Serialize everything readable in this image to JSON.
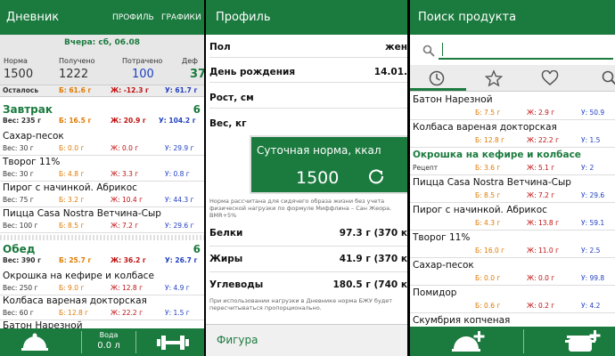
{
  "diary": {
    "title": "Дневник",
    "menu": [
      "ПРОФИЛЬ",
      "ГРАФИКИ"
    ],
    "date": "Вчера: сб, 06.08",
    "stats": [
      {
        "label": "Норма",
        "value": "1500",
        "color": "#222222"
      },
      {
        "label": "Получено",
        "value": "1222",
        "color": "#222222"
      },
      {
        "label": "Потрачено",
        "value": "100",
        "color": "#2040c0"
      },
      {
        "label": "Деф",
        "value": "37",
        "color": "#1b7a3e"
      }
    ],
    "remain": {
      "label": "Осталось",
      "b": "Б: 61.6 г",
      "z": "Ж: -12.3 г",
      "u": "У: 61.7 г"
    },
    "meals": [
      {
        "name": "Завтрак",
        "num": "6",
        "tot": {
          "w": "Вес: 235 г",
          "b": "Б: 16.5 г",
          "z": "Ж: 20.9 г",
          "u": "У: 104.2 г"
        },
        "items": [
          {
            "name": "Сахар-песок",
            "w": "Вес: 30 г",
            "b": "Б: 0.0 г",
            "z": "Ж: 0.0 г",
            "u": "У: 29.9 г"
          },
          {
            "name": "Творог 11%",
            "w": "Вес: 30 г",
            "b": "Б: 4.8 г",
            "z": "Ж: 3.3 г",
            "u": "У: 0.8 г"
          },
          {
            "name": "Пирог с начинкой. Абрикос",
            "w": "Вес: 75 г",
            "b": "Б: 3.2 г",
            "z": "Ж: 10.4 г",
            "u": "У: 44.3 г"
          },
          {
            "name": "Пицца Casa Nostra Ветчина-Сыр",
            "w": "Вес: 100 г",
            "b": "Б: 8.5 г",
            "z": "Ж: 7.2 г",
            "u": "У: 29.6 г"
          }
        ]
      },
      {
        "name": "Обед",
        "num": "6",
        "tot": {
          "w": "Вес: 390 г",
          "b": "Б: 25.7 г",
          "z": "Ж: 36.2 г",
          "u": "У: 26.7 г"
        },
        "items": [
          {
            "name": "Окрошка на кефире и колбасе",
            "w": "Вес: 250 г",
            "b": "Б: 9.0 г",
            "z": "Ж: 12.8 г",
            "u": "У: 4.9 г"
          },
          {
            "name": "Колбаса вареная докторская",
            "w": "Вес: 60 г",
            "b": "Б: 12.8 г",
            "z": "Ж: 22.2 г",
            "u": "У: 1.5 г"
          },
          {
            "name": "Батон Нарезной",
            "w": "",
            "b": "",
            "z": "",
            "u": ""
          }
        ]
      }
    ],
    "bottom": {
      "water_label": "Вода",
      "water_value": "0.0 л"
    }
  },
  "profile": {
    "title": "Профиль",
    "rows": [
      {
        "label": "Пол",
        "value": "жен"
      },
      {
        "label": "День рождения",
        "value": "14.01."
      },
      {
        "label": "Рост, см",
        "value": ""
      },
      {
        "label": "Вес, кг",
        "value": ""
      }
    ],
    "dialog": {
      "title": "Суточная норма, ккал",
      "value": "1500"
    },
    "note1": "Норма рассчитана для сидячего образа жизни без учета физической нагрузки по формуле Миффлина – Сан Жеора. BMR+5%",
    "macros": [
      {
        "label": "Белки",
        "value": "97.3 г (370 к"
      },
      {
        "label": "Жиры",
        "value": "41.9 г (370 к"
      },
      {
        "label": "Углеводы",
        "value": "180.5 г (740 к"
      }
    ],
    "note2": "При использовании нагрузки в Дневнике норма БЖУ будет пересчитываться пропорционально.",
    "figure": "Фигура"
  },
  "search": {
    "title": "Поиск продукта",
    "placeholder": "",
    "products": [
      {
        "name": "Батон Нарезной",
        "green": false,
        "a": "",
        "b": "Б: 7.5 г",
        "z": "Ж: 2.9 г",
        "u": "У: 50.9"
      },
      {
        "name": "Колбаса вареная докторская",
        "green": false,
        "a": "",
        "b": "Б: 12.8 г",
        "z": "Ж: 22.2 г",
        "u": "У: 1.5"
      },
      {
        "name": "Окрошка на кефире и колбасе",
        "green": true,
        "a": "Рецепт",
        "b": "Б: 3.6 г",
        "z": "Ж: 5.1 г",
        "u": "У: 2"
      },
      {
        "name": "Пицца Casa Nostra Ветчина-Сыр",
        "green": false,
        "a": "",
        "b": "Б: 8.5 г",
        "z": "Ж: 7.2 г",
        "u": "У: 29.6"
      },
      {
        "name": "Пирог с начинкой. Абрикос",
        "green": false,
        "a": "",
        "b": "Б: 4.3 г",
        "z": "Ж: 13.8 г",
        "u": "У: 59.1"
      },
      {
        "name": "Творог 11%",
        "green": false,
        "a": "",
        "b": "Б: 16.0 г",
        "z": "Ж: 11.0 г",
        "u": "У: 2.5"
      },
      {
        "name": "Сахар-песок",
        "green": false,
        "a": "",
        "b": "Б: 0.0 г",
        "z": "Ж: 0.0 г",
        "u": "У: 99.8"
      },
      {
        "name": "Помидор",
        "green": false,
        "a": "",
        "b": "Б: 0.6 г",
        "z": "Ж: 0.2 г",
        "u": "У: 4.2"
      },
      {
        "name": "Скумбрия копченая",
        "green": false,
        "a": "",
        "b": "",
        "z": "",
        "u": ""
      }
    ]
  },
  "colors": {
    "brand": "#1b7a3e",
    "protein": "#e07a00",
    "fat": "#c01010",
    "carb": "#2040c0"
  }
}
